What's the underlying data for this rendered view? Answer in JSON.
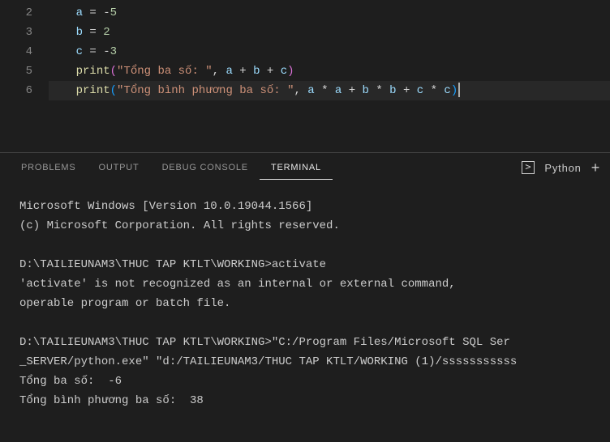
{
  "editor": {
    "lines": [
      {
        "num": "2",
        "tokens": [
          {
            "cls": "tok-var",
            "t": "a"
          },
          {
            "cls": "tok-op",
            "t": " "
          },
          {
            "cls": "tok-op",
            "t": "="
          },
          {
            "cls": "tok-op",
            "t": " "
          },
          {
            "cls": "tok-op",
            "t": "-"
          },
          {
            "cls": "tok-num",
            "t": "5"
          }
        ]
      },
      {
        "num": "3",
        "tokens": [
          {
            "cls": "tok-var",
            "t": "b"
          },
          {
            "cls": "tok-op",
            "t": " "
          },
          {
            "cls": "tok-op",
            "t": "="
          },
          {
            "cls": "tok-op",
            "t": " "
          },
          {
            "cls": "tok-num",
            "t": "2"
          }
        ]
      },
      {
        "num": "4",
        "tokens": [
          {
            "cls": "tok-var",
            "t": "c"
          },
          {
            "cls": "tok-op",
            "t": " "
          },
          {
            "cls": "tok-op",
            "t": "="
          },
          {
            "cls": "tok-op",
            "t": " "
          },
          {
            "cls": "tok-op",
            "t": "-"
          },
          {
            "cls": "tok-num",
            "t": "3"
          }
        ]
      },
      {
        "num": "5",
        "tokens": [
          {
            "cls": "tok-fn",
            "t": "print"
          },
          {
            "cls": "tok-paren",
            "t": "("
          },
          {
            "cls": "tok-str",
            "t": "\"Tổng ba số: \""
          },
          {
            "cls": "tok-comma",
            "t": ","
          },
          {
            "cls": "tok-op",
            "t": " "
          },
          {
            "cls": "tok-var",
            "t": "a"
          },
          {
            "cls": "tok-op",
            "t": " "
          },
          {
            "cls": "tok-op",
            "t": "+"
          },
          {
            "cls": "tok-op",
            "t": " "
          },
          {
            "cls": "tok-var",
            "t": "b"
          },
          {
            "cls": "tok-op",
            "t": " "
          },
          {
            "cls": "tok-op",
            "t": "+"
          },
          {
            "cls": "tok-op",
            "t": " "
          },
          {
            "cls": "tok-var",
            "t": "c"
          },
          {
            "cls": "tok-paren",
            "t": ")"
          }
        ]
      },
      {
        "num": "6",
        "tokens": [
          {
            "cls": "tok-fn",
            "t": "print"
          },
          {
            "cls": "tok-paren2",
            "t": "("
          },
          {
            "cls": "tok-str",
            "t": "\"Tổng bình phương ba số: \""
          },
          {
            "cls": "tok-comma",
            "t": ","
          },
          {
            "cls": "tok-op",
            "t": " "
          },
          {
            "cls": "tok-var",
            "t": "a"
          },
          {
            "cls": "tok-op",
            "t": " "
          },
          {
            "cls": "tok-op",
            "t": "*"
          },
          {
            "cls": "tok-op",
            "t": " "
          },
          {
            "cls": "tok-var",
            "t": "a"
          },
          {
            "cls": "tok-op",
            "t": " "
          },
          {
            "cls": "tok-op",
            "t": "+"
          },
          {
            "cls": "tok-op",
            "t": " "
          },
          {
            "cls": "tok-var",
            "t": "b"
          },
          {
            "cls": "tok-op",
            "t": " "
          },
          {
            "cls": "tok-op",
            "t": "*"
          },
          {
            "cls": "tok-op",
            "t": " "
          },
          {
            "cls": "tok-var",
            "t": "b"
          },
          {
            "cls": "tok-op",
            "t": " "
          },
          {
            "cls": "tok-op",
            "t": "+"
          },
          {
            "cls": "tok-op",
            "t": " "
          },
          {
            "cls": "tok-var",
            "t": "c"
          },
          {
            "cls": "tok-op",
            "t": " "
          },
          {
            "cls": "tok-op",
            "t": "*"
          },
          {
            "cls": "tok-op",
            "t": " "
          },
          {
            "cls": "tok-var",
            "t": "c"
          },
          {
            "cls": "tok-paren2",
            "t": ")"
          }
        ],
        "highlighted": true,
        "cursor": true
      }
    ]
  },
  "panel": {
    "tabs": {
      "problems": "PROBLEMS",
      "output": "OUTPUT",
      "debug": "DEBUG CONSOLE",
      "terminal": "TERMINAL"
    },
    "active": "terminal",
    "launcher_label": "Python",
    "plus_symbol": "+"
  },
  "terminal": {
    "lines": [
      "Microsoft Windows [Version 10.0.19044.1566]",
      "(c) Microsoft Corporation. All rights reserved.",
      "",
      "D:\\TAILIEUNAM3\\THUC TAP KTLT\\WORKING>activate",
      "'activate' is not recognized as an internal or external command,",
      "operable program or batch file.",
      "",
      "D:\\TAILIEUNAM3\\THUC TAP KTLT\\WORKING>\"C:/Program Files/Microsoft SQL Ser",
      "_SERVER/python.exe\" \"d:/TAILIEUNAM3/THUC TAP KTLT/WORKING (1)/sssssssssss",
      "Tổng ba số:  -6",
      "Tổng bình phương ba số:  38"
    ]
  }
}
